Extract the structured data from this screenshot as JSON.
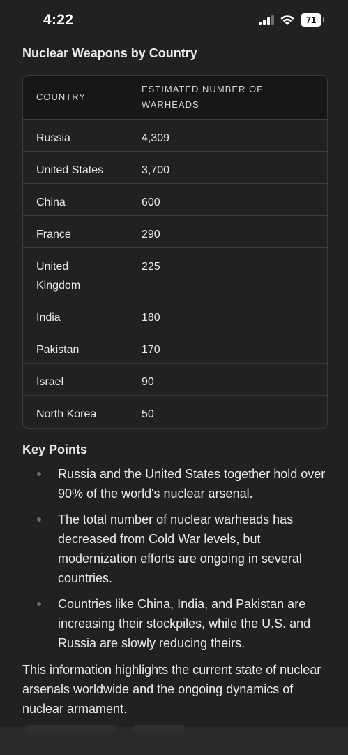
{
  "status_bar": {
    "time": "4:22",
    "battery": "71"
  },
  "heading": "Nuclear Weapons by Country",
  "table": {
    "columns": [
      "Country",
      "Estimated Number of Warheads"
    ],
    "rows": [
      {
        "country": "Russia",
        "warheads": "4,309"
      },
      {
        "country": "United States",
        "warheads": "3,700"
      },
      {
        "country": "China",
        "warheads": "600"
      },
      {
        "country": "France",
        "warheads": "290"
      },
      {
        "country": "United Kingdom",
        "warheads": "225"
      },
      {
        "country": "India",
        "warheads": "180"
      },
      {
        "country": "Pakistan",
        "warheads": "170"
      },
      {
        "country": "Israel",
        "warheads": "90"
      },
      {
        "country": "North Korea",
        "warheads": "50"
      }
    ]
  },
  "key_points": {
    "title": "Key Points",
    "items": [
      "Russia and the United States together hold over 90% of the world's nuclear arsenal.",
      "The total number of nuclear warheads has decreased from Cold War levels, but modernization efforts are ongoing in several countries.",
      "Countries like China, India, and Pakistan are increasing their stockpiles, while the U.S. and Russia are slowly reducing theirs."
    ]
  },
  "summary": "This information highlights the current state of nuclear arsenals worldwide and the ongoing dynamics of nuclear armament.",
  "icons": {
    "signal": "cellular-signal-icon",
    "wifi": "wifi-icon",
    "battery": "battery-icon"
  }
}
